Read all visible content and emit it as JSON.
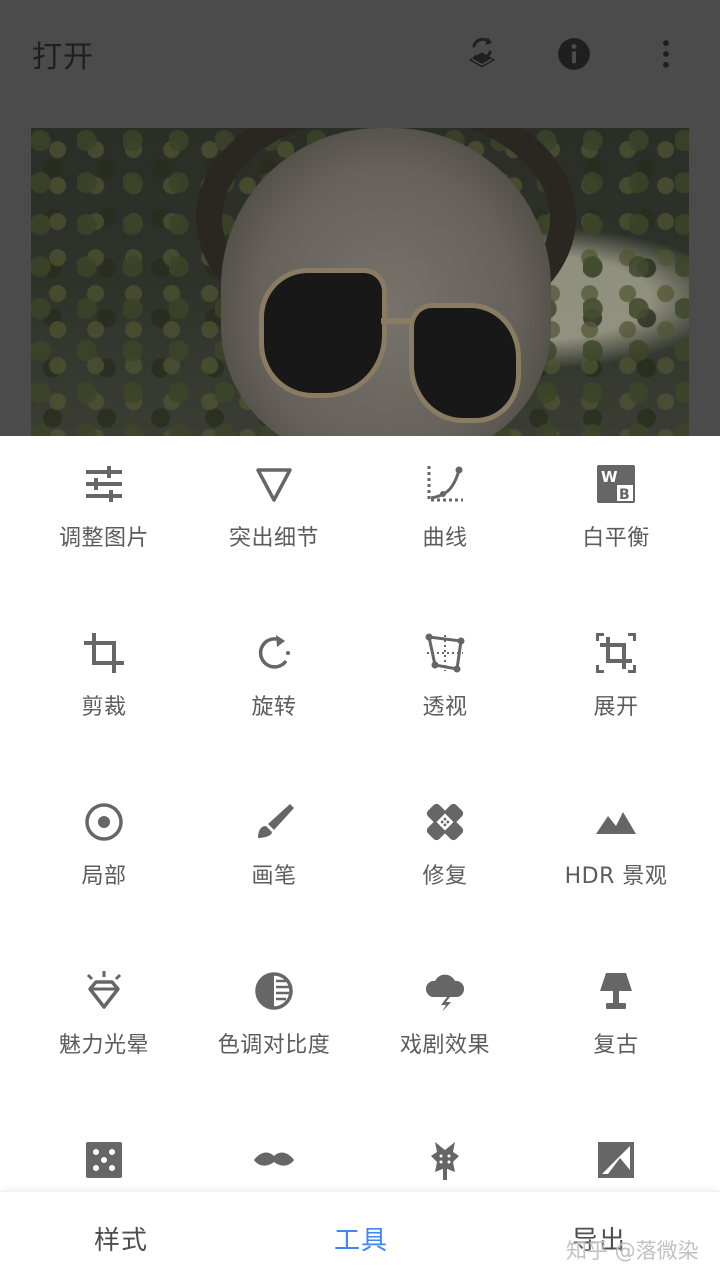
{
  "app_bar": {
    "title": "打开"
  },
  "tools": [
    {
      "label": "调整图片",
      "icon": "tune-sliders-icon"
    },
    {
      "label": "突出细节",
      "icon": "triangle-details-icon"
    },
    {
      "label": "曲线",
      "icon": "curves-icon"
    },
    {
      "label": "白平衡",
      "icon": "white-balance-icon",
      "icon_text_w": "W",
      "icon_text_b": "B"
    },
    {
      "label": "剪裁",
      "icon": "crop-icon"
    },
    {
      "label": "旋转",
      "icon": "rotate-icon"
    },
    {
      "label": "透视",
      "icon": "perspective-icon"
    },
    {
      "label": "展开",
      "icon": "expand-icon"
    },
    {
      "label": "局部",
      "icon": "selective-icon"
    },
    {
      "label": "画笔",
      "icon": "brush-icon"
    },
    {
      "label": "修复",
      "icon": "healing-icon"
    },
    {
      "label": "HDR 景观",
      "icon": "hdr-landscape-icon"
    },
    {
      "label": "魅力光晕",
      "icon": "glamour-glow-icon"
    },
    {
      "label": "色调对比度",
      "icon": "tonal-contrast-icon"
    },
    {
      "label": "戏剧效果",
      "icon": "drama-icon"
    },
    {
      "label": "复古",
      "icon": "vintage-lamp-icon"
    },
    {
      "label": "",
      "icon": "grainy-film-icon"
    },
    {
      "label": "",
      "icon": "mustache-icon"
    },
    {
      "label": "",
      "icon": "grunge-guitar-icon"
    },
    {
      "label": "",
      "icon": "black-white-icon"
    }
  ],
  "bottom_nav": [
    {
      "label": "样式",
      "active": false
    },
    {
      "label": "工具",
      "active": true
    },
    {
      "label": "导出",
      "active": false
    }
  ],
  "watermark": "知乎 @落微染",
  "colors": {
    "accent": "#4285f4",
    "icon": "#666666",
    "label": "#5c5c5c",
    "overlay": "#4b4b4b"
  }
}
